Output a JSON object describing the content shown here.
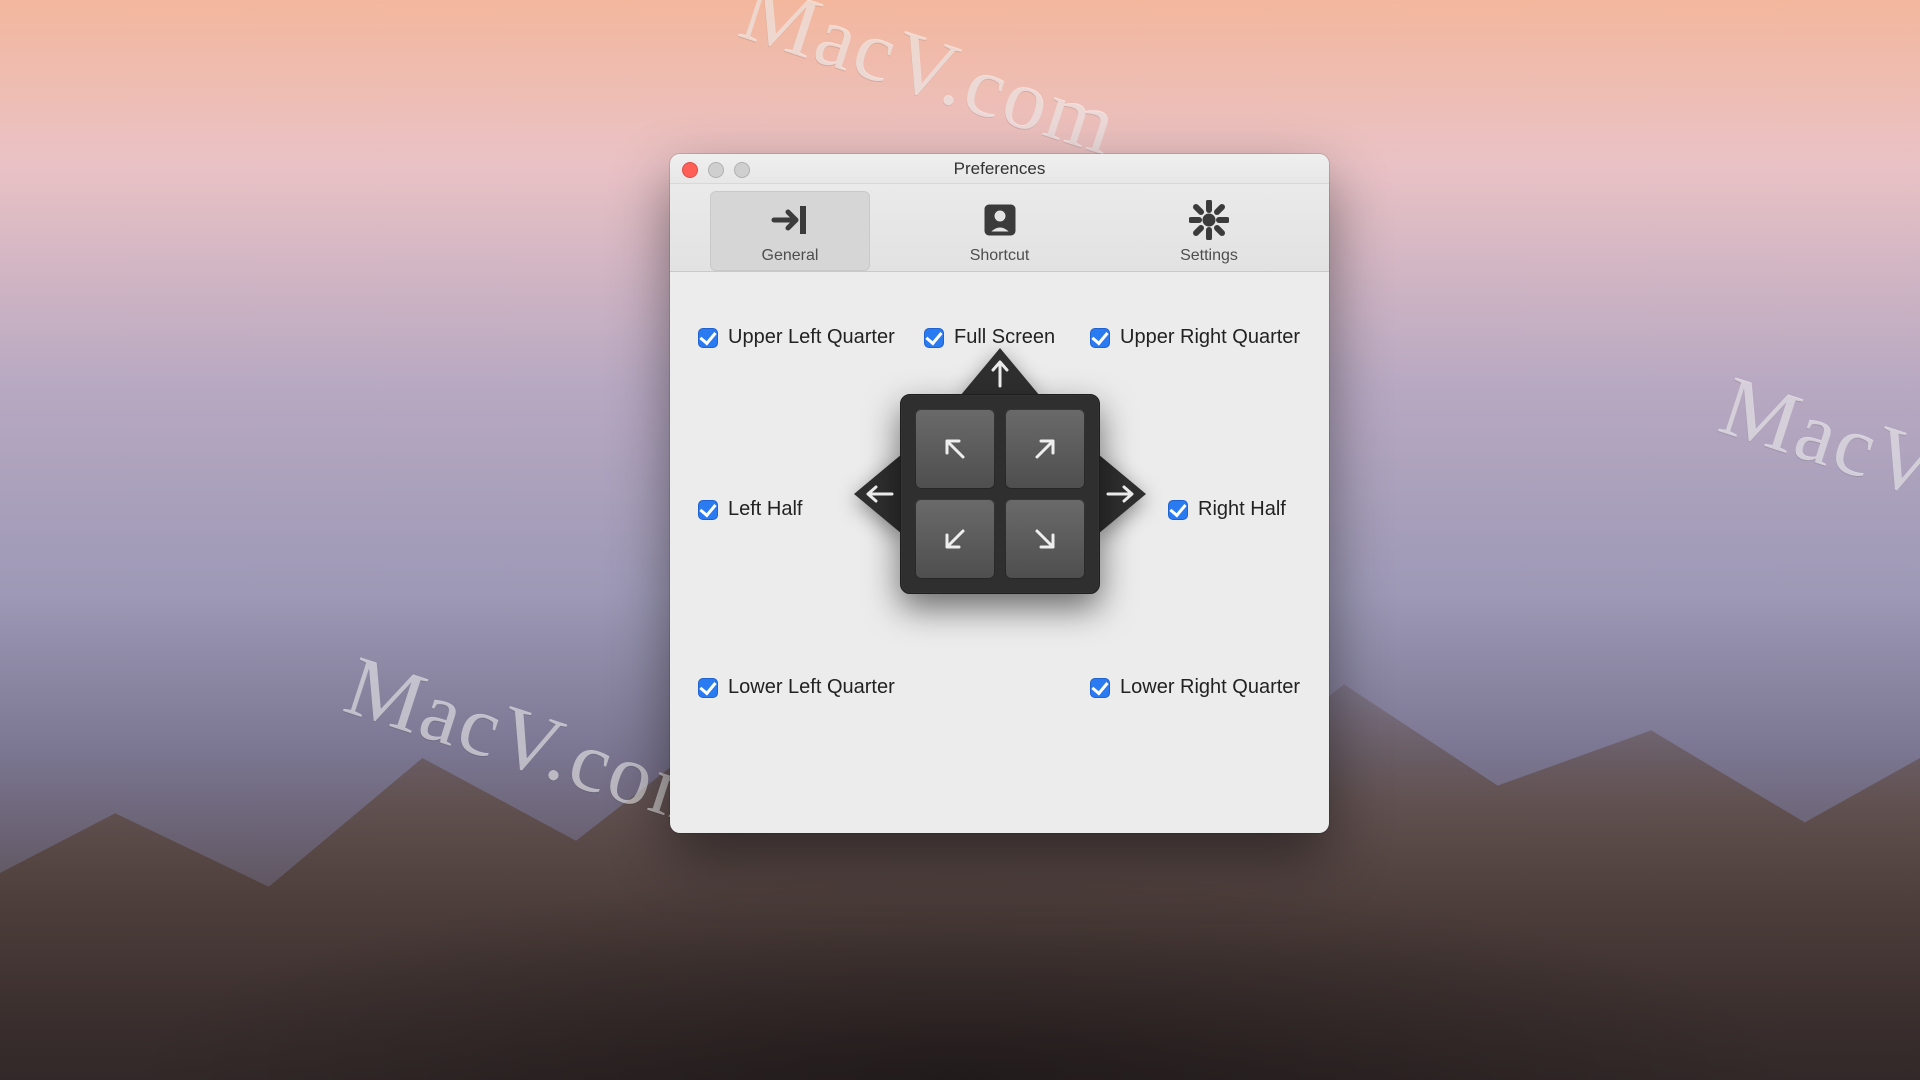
{
  "watermark_text": "MacV.com",
  "window": {
    "title": "Preferences",
    "tabs": {
      "general": {
        "label": "General",
        "selected": true
      },
      "shortcut": {
        "label": "Shortcut",
        "selected": false
      },
      "settings": {
        "label": "Settings",
        "selected": false
      }
    }
  },
  "options": {
    "upper_left_quarter": {
      "label": "Upper Left Quarter",
      "checked": true
    },
    "full_screen": {
      "label": "Full Screen",
      "checked": true
    },
    "upper_right_quarter": {
      "label": "Upper Right Quarter",
      "checked": true
    },
    "left_half": {
      "label": "Left Half",
      "checked": true
    },
    "right_half": {
      "label": "Right Half",
      "checked": true
    },
    "lower_left_quarter": {
      "label": "Lower Left Quarter",
      "checked": true
    },
    "lower_right_quarter": {
      "label": "Lower Right Quarter",
      "checked": true
    }
  }
}
